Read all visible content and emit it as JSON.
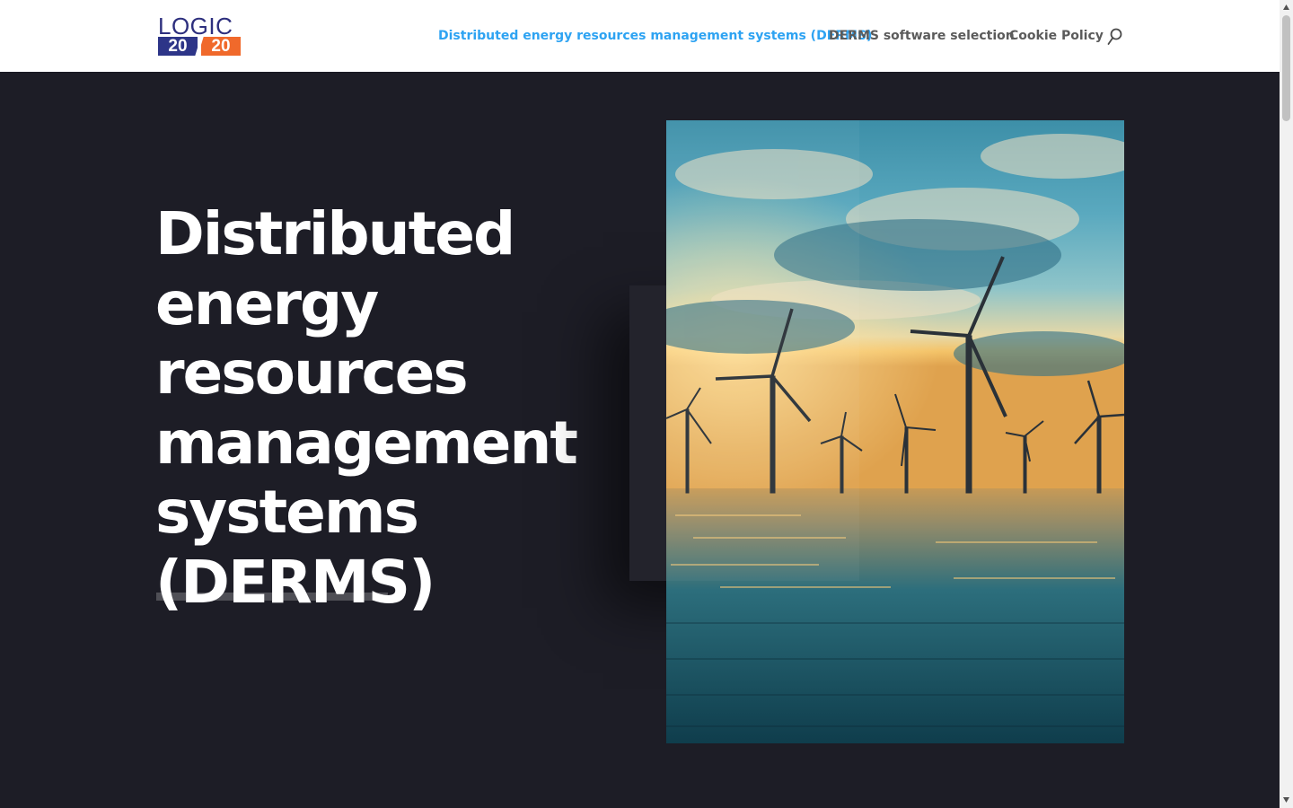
{
  "logo": {
    "top": "LOGIC",
    "left_number": "20",
    "right_number": "20"
  },
  "nav": {
    "items": [
      {
        "label": "Distributed energy resources management systems (DERMS)",
        "active": true
      },
      {
        "label": "DERMS software selection",
        "active": false
      },
      {
        "label": "Cookie Policy",
        "active": false
      }
    ],
    "search_icon": "search-icon"
  },
  "hero": {
    "title_lines": [
      "Distributed",
      "energy",
      "resources",
      "management",
      "systems",
      "(DERMS)"
    ],
    "image": "offshore-wind-turbines-at-sunset"
  },
  "colors": {
    "background": "#1d1d26",
    "header": "#ffffff",
    "nav_active": "#2ea3f2",
    "nav_default": "#5b5b5b",
    "logo_blue": "#2d3588",
    "logo_orange": "#f0692b"
  }
}
